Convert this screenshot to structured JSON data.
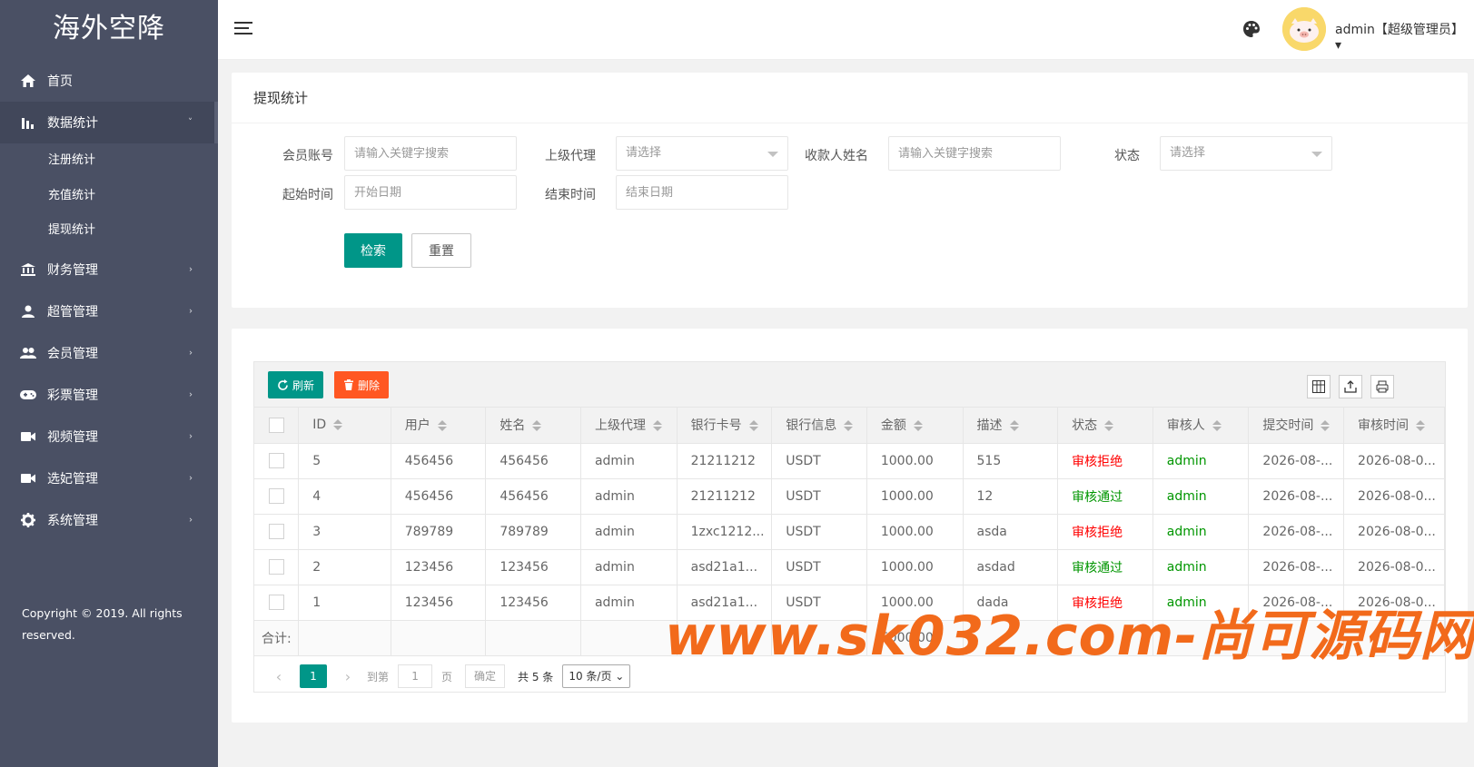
{
  "brand": "海外空降",
  "sidebar": {
    "items": [
      {
        "label": "首页",
        "icon": "home-icon"
      },
      {
        "label": "数据统计",
        "icon": "bar-chart-icon"
      },
      {
        "label": "财务管理",
        "icon": "bank-icon"
      },
      {
        "label": "超管管理",
        "icon": "user-icon"
      },
      {
        "label": "会员管理",
        "icon": "users-icon"
      },
      {
        "label": "彩票管理",
        "icon": "gamepad-icon"
      },
      {
        "label": "视频管理",
        "icon": "video-icon"
      },
      {
        "label": "选妃管理",
        "icon": "video-icon"
      },
      {
        "label": "系统管理",
        "icon": "gear-icon"
      }
    ],
    "sub_items": [
      "注册统计",
      "充值统计",
      "提现统计"
    ],
    "copyright": "Copyright © 2019. All rights reserved."
  },
  "header": {
    "user": "admin【超级管理员】"
  },
  "search": {
    "title": "提现统计",
    "member_label": "会员账号",
    "member_placeholder": "请输入关键字搜索",
    "agent_label": "上级代理",
    "agent_value": "请选择",
    "payee_label": "收款人姓名",
    "payee_placeholder": "请输入关键字搜索",
    "status_label": "状态",
    "status_value": "请选择",
    "start_label": "起始时间",
    "start_placeholder": "开始日期",
    "end_label": "结束时间",
    "end_placeholder": "结束日期",
    "search_btn": "检索",
    "reset_btn": "重置"
  },
  "toolbar": {
    "refresh": "刷新",
    "delete": "删除"
  },
  "table": {
    "columns": [
      "ID",
      "用户",
      "姓名",
      "上级代理",
      "银行卡号",
      "银行信息",
      "金额",
      "描述",
      "状态",
      "审核人",
      "提交时间",
      "审核时间"
    ],
    "rows": [
      {
        "id": "5",
        "user": "456456",
        "name": "456456",
        "agent": "admin",
        "card": "21211212",
        "bank": "USDT",
        "amount": "1000.00",
        "desc": "515",
        "status": "审核拒绝",
        "status_type": "reject",
        "auditor": "admin",
        "submit": "2026-08-...",
        "audit": "2026-08-0..."
      },
      {
        "id": "4",
        "user": "456456",
        "name": "456456",
        "agent": "admin",
        "card": "21211212",
        "bank": "USDT",
        "amount": "1000.00",
        "desc": "12",
        "status": "审核通过",
        "status_type": "pass",
        "auditor": "admin",
        "submit": "2026-08-...",
        "audit": "2026-08-0..."
      },
      {
        "id": "3",
        "user": "789789",
        "name": "789789",
        "agent": "admin",
        "card": "1zxc1212...",
        "bank": "USDT",
        "amount": "1000.00",
        "desc": "asda",
        "status": "审核拒绝",
        "status_type": "reject",
        "auditor": "admin",
        "submit": "2026-08-...",
        "audit": "2026-08-0..."
      },
      {
        "id": "2",
        "user": "123456",
        "name": "123456",
        "agent": "admin",
        "card": "asd21a1...",
        "bank": "USDT",
        "amount": "1000.00",
        "desc": "asdad",
        "status": "审核通过",
        "status_type": "pass",
        "auditor": "admin",
        "submit": "2026-08-...",
        "audit": "2026-08-0..."
      },
      {
        "id": "1",
        "user": "123456",
        "name": "123456",
        "agent": "admin",
        "card": "asd21a1...",
        "bank": "USDT",
        "amount": "1000.00",
        "desc": "dada",
        "status": "审核拒绝",
        "status_type": "reject",
        "auditor": "admin",
        "submit": "2026-08-...",
        "audit": "2026-08-0..."
      }
    ],
    "total_label": "合计:",
    "total_amount": "5000.00"
  },
  "pager": {
    "current": "1",
    "goto": "到第",
    "page_input": "1",
    "page_unit": "页",
    "confirm": "确定",
    "count": "共 5 条",
    "size": "10 条/页"
  },
  "watermark": "www.sk032.com-尚可源码网",
  "colors": {
    "primary": "#009688",
    "danger": "#ff5722",
    "reject": "#ff0000",
    "pass": "#009600",
    "sidebar": "#4a5064"
  }
}
